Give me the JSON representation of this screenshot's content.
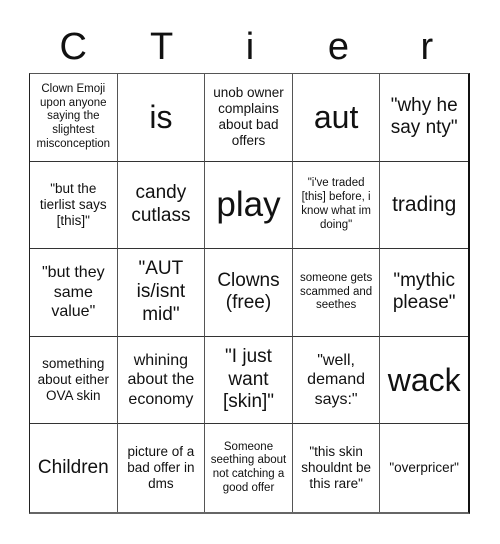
{
  "title": {
    "letters": [
      "C",
      "T",
      "i",
      "e",
      "r"
    ]
  },
  "board": {
    "cells": [
      {
        "text": "Clown Emoji upon anyone saying the slightest misconception",
        "size": "s-xs"
      },
      {
        "text": "is",
        "size": "s-xxl"
      },
      {
        "text": "unob owner complains about bad offers",
        "size": "s-sm"
      },
      {
        "text": "aut",
        "size": "s-xxl"
      },
      {
        "text": "\"why he say nty\"",
        "size": "s-lg"
      },
      {
        "text": "\"but the tierlist says [this]\"",
        "size": "s-sm"
      },
      {
        "text": "candy cutlass",
        "size": "s-lg"
      },
      {
        "text": "play",
        "size": "s-huge"
      },
      {
        "text": "\"i've traded [this] before, i know what im doing\"",
        "size": "s-xs"
      },
      {
        "text": "trading",
        "size": "s-xl"
      },
      {
        "text": "\"but they same value\"",
        "size": "s-md"
      },
      {
        "text": "\"AUT is/isnt mid\"",
        "size": "s-lg"
      },
      {
        "text": "Clowns (free)",
        "size": "s-lg"
      },
      {
        "text": "someone gets scammed and seethes",
        "size": "s-xs"
      },
      {
        "text": "\"mythic please\"",
        "size": "s-lg"
      },
      {
        "text": "something about either OVA skin",
        "size": "s-sm"
      },
      {
        "text": "whining about the economy",
        "size": "s-md"
      },
      {
        "text": "\"I just want [skin]\"",
        "size": "s-lg"
      },
      {
        "text": "\"well, demand says:\"",
        "size": "s-md"
      },
      {
        "text": "wack",
        "size": "s-xxl"
      },
      {
        "text": "Children",
        "size": "s-lg"
      },
      {
        "text": "picture of a bad offer in dms",
        "size": "s-sm"
      },
      {
        "text": "Someone seething about not catching a good offer",
        "size": "s-xs"
      },
      {
        "text": "\"this skin shouldnt be this rare\"",
        "size": "s-sm"
      },
      {
        "text": "\"overpricer\"",
        "size": "s-sm"
      }
    ]
  }
}
